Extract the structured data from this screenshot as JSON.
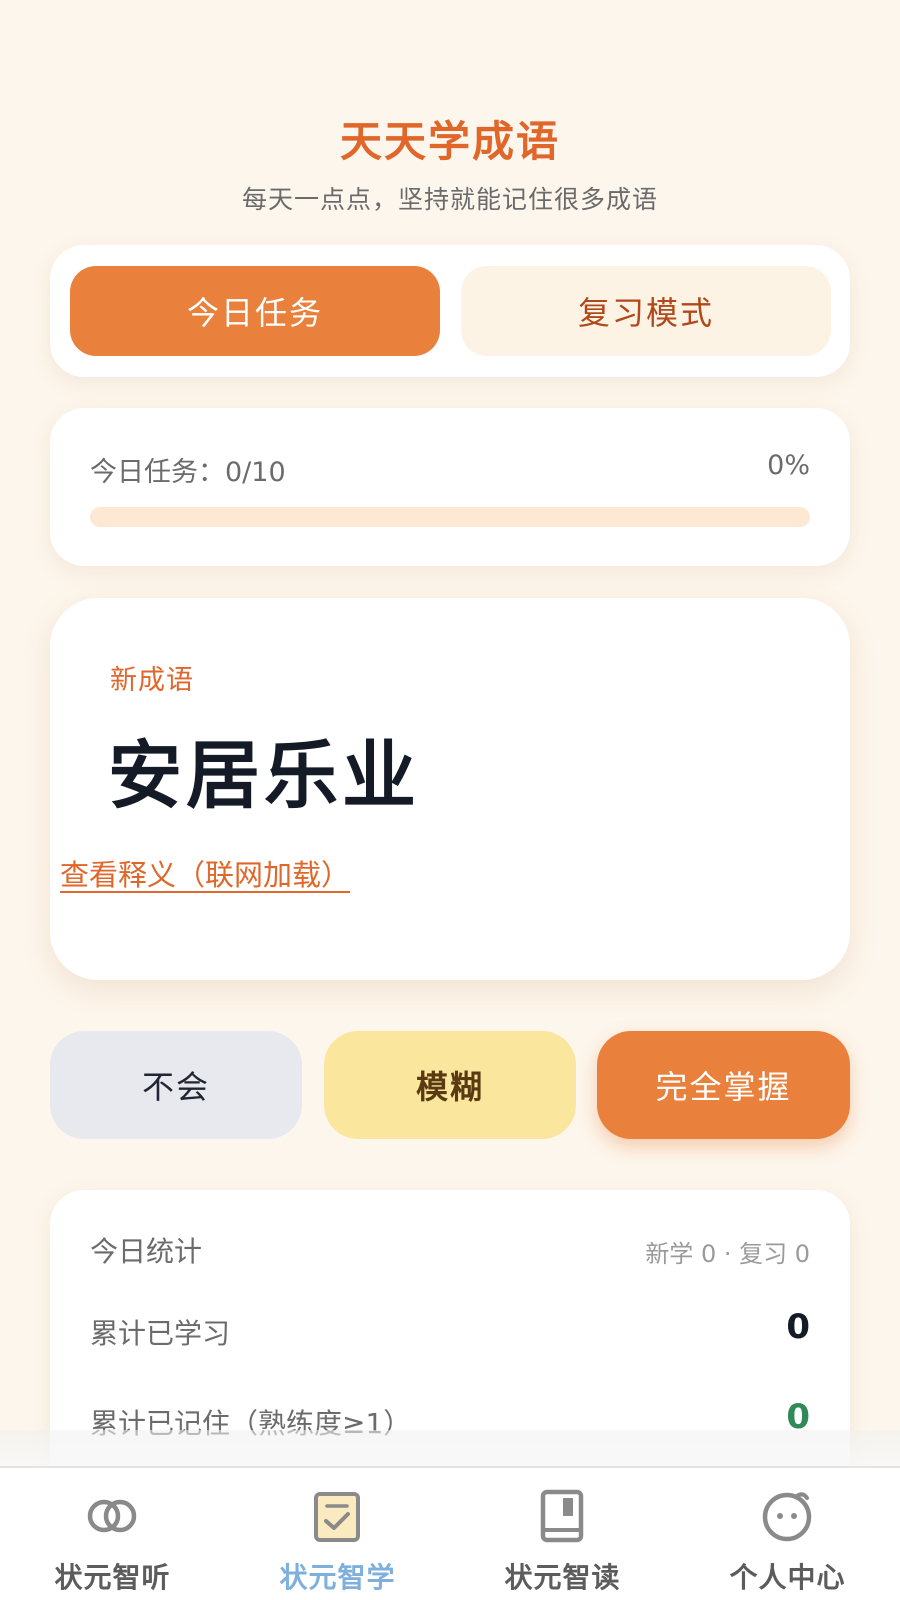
{
  "header": {
    "title": "天天学成语",
    "subtitle": "每天一点点，坚持就能记住很多成语"
  },
  "modes": {
    "active_label": "今日任务",
    "inactive_label": "复习模式"
  },
  "progress": {
    "label": "今日任务：0/10",
    "percent_text": "0%",
    "fraction": 0
  },
  "idiom": {
    "tag": "新成语",
    "word": "安居乐业",
    "link": "查看释义（联网加载）"
  },
  "rating": {
    "unknown": "不会",
    "fuzzy": "模糊",
    "master": "完全掌握"
  },
  "stats": {
    "title": "今日统计",
    "summary": "新学 0 · 复习 0",
    "rows": [
      {
        "label": "累计已学习",
        "value": "0"
      },
      {
        "label": "累计已记住（熟练度≥1）",
        "value": "0"
      }
    ]
  },
  "nav": {
    "items": [
      {
        "label": "状元智听",
        "icon": "rings-icon"
      },
      {
        "label": "状元智学",
        "icon": "checklist-icon"
      },
      {
        "label": "状元智读",
        "icon": "book-icon"
      },
      {
        "label": "个人中心",
        "icon": "face-icon"
      }
    ],
    "active_index": 1
  },
  "colors": {
    "accent": "#e9803c",
    "title": "#e0662a",
    "background": "#fdf6ec",
    "fuzzy": "#fbe69d",
    "unknown": "#e8e9ee",
    "success": "#2f8a57",
    "nav_active": "#7fb0dd"
  }
}
